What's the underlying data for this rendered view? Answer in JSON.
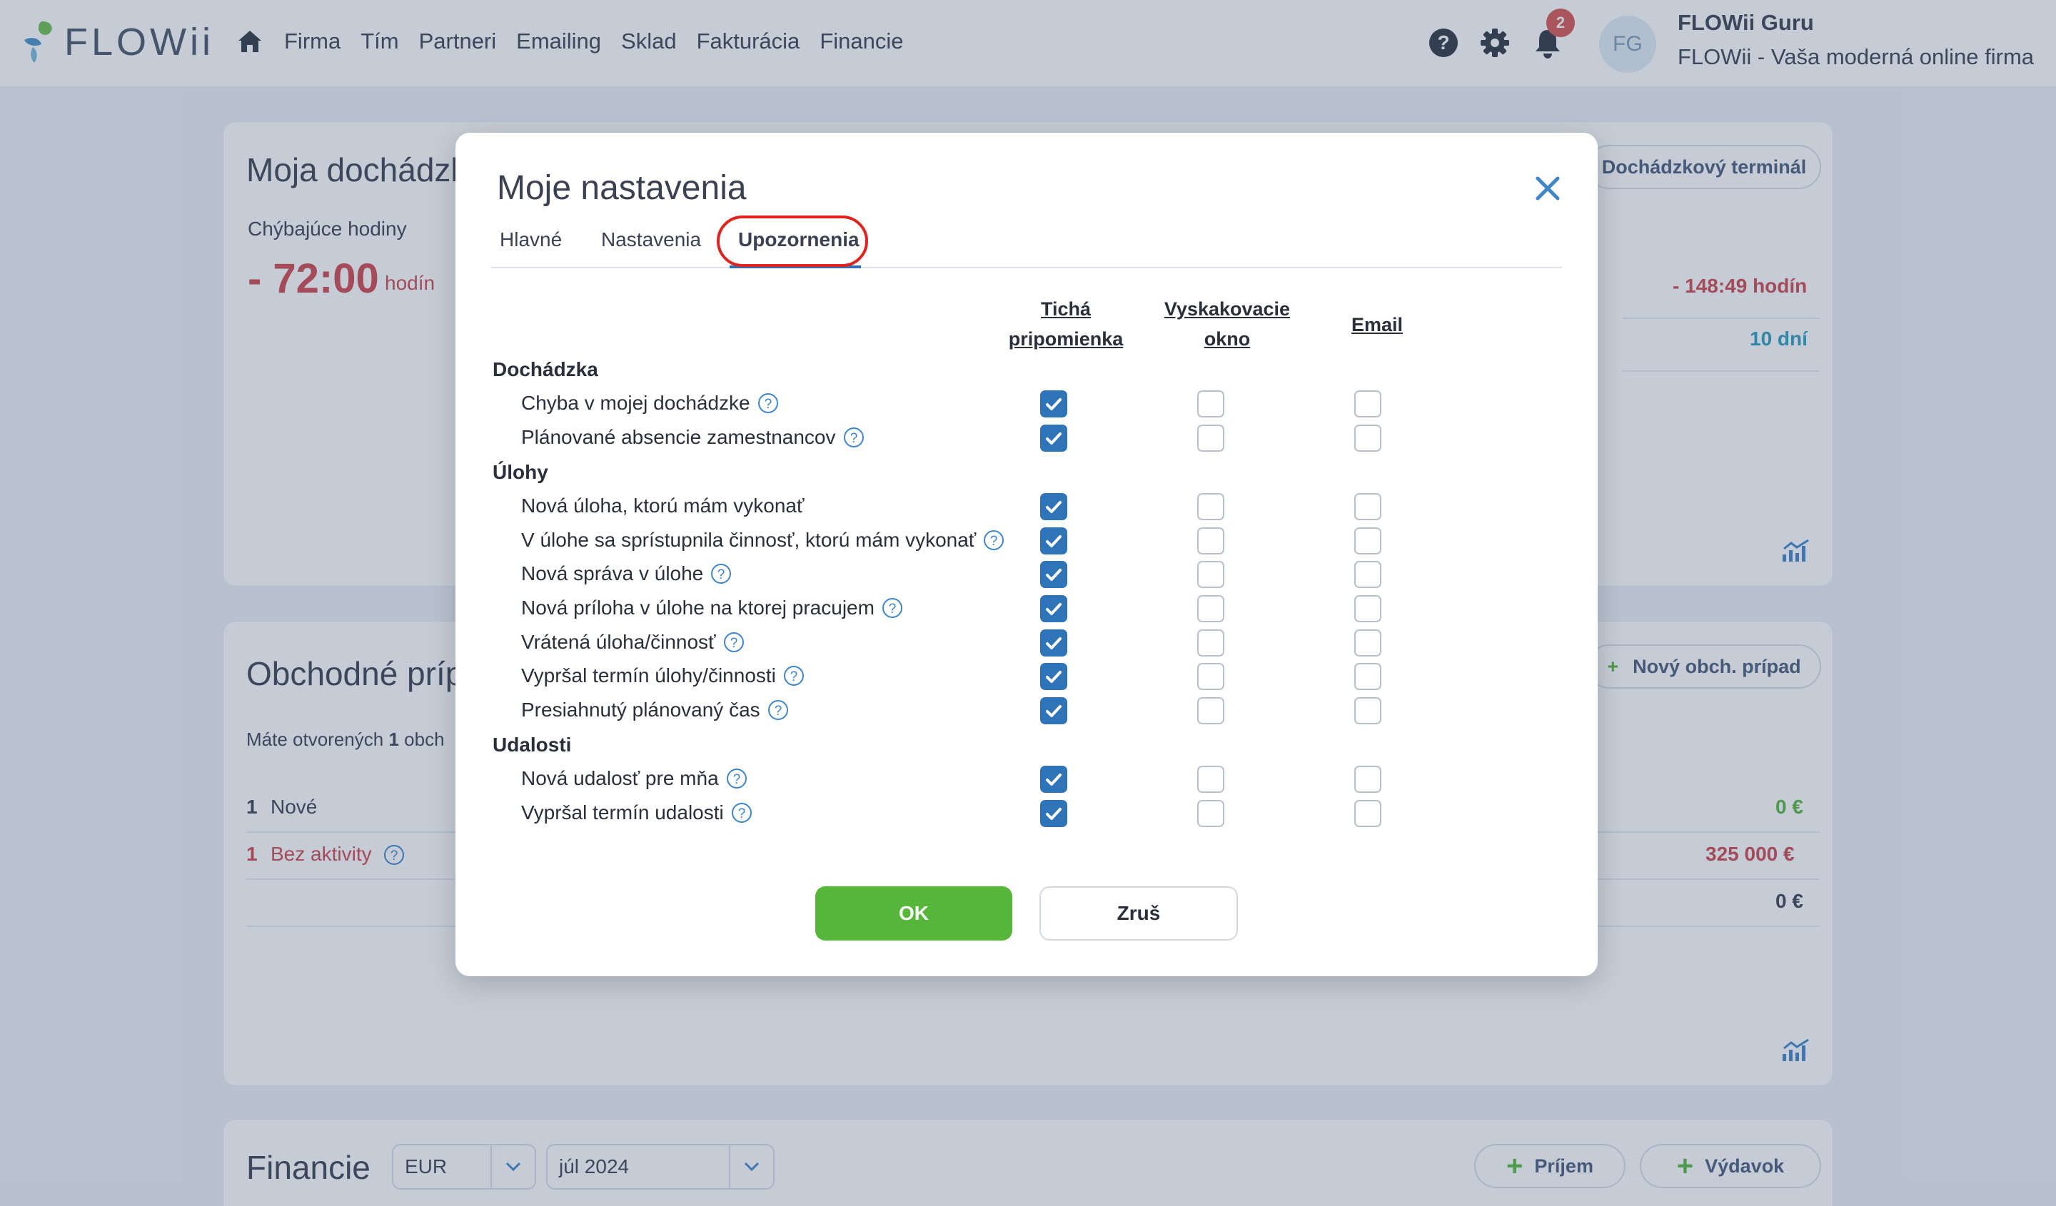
{
  "app": {
    "logo_text": "FLOWii"
  },
  "nav": {
    "items": [
      "Firma",
      "Tím",
      "Partneri",
      "Emailing",
      "Sklad",
      "Fakturácia",
      "Financie"
    ],
    "notifications_count": "2",
    "avatar_initials": "FG",
    "user_name": "FLOWii Guru",
    "user_company": "FLOWii - Vaša moderná online firma"
  },
  "attendance_card": {
    "title": "Moja dochádzka",
    "missing_label": "Chýbajúce hodiny",
    "missing_value": "- 72:00",
    "missing_unit": "hodín",
    "terminal_button": "Dochádzkový terminál",
    "right_value_1": "- 148:49 hodín",
    "right_value_2": "10 dní"
  },
  "deals_card": {
    "title": "Obchodné prípady",
    "new_button": "Nový obch. prípad",
    "open_text_prefix": "Máte otvorených",
    "open_count": "1",
    "open_text_suffix": "obch",
    "rows": [
      {
        "count": "1",
        "label": "Nové",
        "value": "0 €"
      },
      {
        "count": "1",
        "label": "Bez aktivity",
        "value": "325 000 €"
      },
      {
        "count": "",
        "label": "",
        "value": "0 €"
      }
    ]
  },
  "finance_card": {
    "title": "Financie",
    "currency": "EUR",
    "month": "júl 2024",
    "income_button": "Príjem",
    "expense_button": "Výdavok"
  },
  "modal": {
    "title": "Moje nastavenia",
    "tabs": [
      "Hlavné",
      "Nastavenia",
      "Upozornenia"
    ],
    "active_tab": "Upozornenia",
    "columns": [
      {
        "line1": "Tichá",
        "line2": "pripomienka"
      },
      {
        "line1": "Vyskakovacie",
        "line2": "okno"
      },
      {
        "line1": "Email",
        "line2": ""
      }
    ],
    "sections": [
      {
        "name": "Dochádzka",
        "rows": [
          {
            "label": "Chyba v mojej dochádzke",
            "help": true,
            "silent": true,
            "popup": false,
            "email": false
          },
          {
            "label": "Plánované absencie zamestnancov",
            "help": true,
            "silent": true,
            "popup": false,
            "email": false
          }
        ]
      },
      {
        "name": "Úlohy",
        "rows": [
          {
            "label": "Nová úloha, ktorú mám vykonať",
            "help": false,
            "silent": true,
            "popup": false,
            "email": false
          },
          {
            "label": "V úlohe sa sprístupnila činnosť, ktorú mám vykonať",
            "help": true,
            "silent": true,
            "popup": false,
            "email": false
          },
          {
            "label": "Nová správa v úlohe",
            "help": true,
            "silent": true,
            "popup": false,
            "email": false
          },
          {
            "label": "Nová príloha v úlohe na ktorej pracujem",
            "help": true,
            "silent": true,
            "popup": false,
            "email": false
          },
          {
            "label": "Vrátená úloha/činnosť",
            "help": true,
            "silent": true,
            "popup": false,
            "email": false
          },
          {
            "label": "Vypršal termín úlohy/činnosti",
            "help": true,
            "silent": true,
            "popup": false,
            "email": false
          },
          {
            "label": "Presiahnutý plánovaný čas",
            "help": true,
            "silent": true,
            "popup": false,
            "email": false
          }
        ]
      },
      {
        "name": "Udalosti",
        "rows": [
          {
            "label": "Nová udalosť pre mňa",
            "help": true,
            "silent": true,
            "popup": false,
            "email": false
          },
          {
            "label": "Vypršal termín udalosti",
            "help": true,
            "silent": true,
            "popup": false,
            "email": false
          }
        ]
      }
    ],
    "ok_label": "OK",
    "cancel_label": "Zruš"
  },
  "colors": {
    "accent_blue": "#2f73b8",
    "ok_green": "#56b63a",
    "negative_red": "#d0454c",
    "highlight_red": "#e0231c"
  }
}
